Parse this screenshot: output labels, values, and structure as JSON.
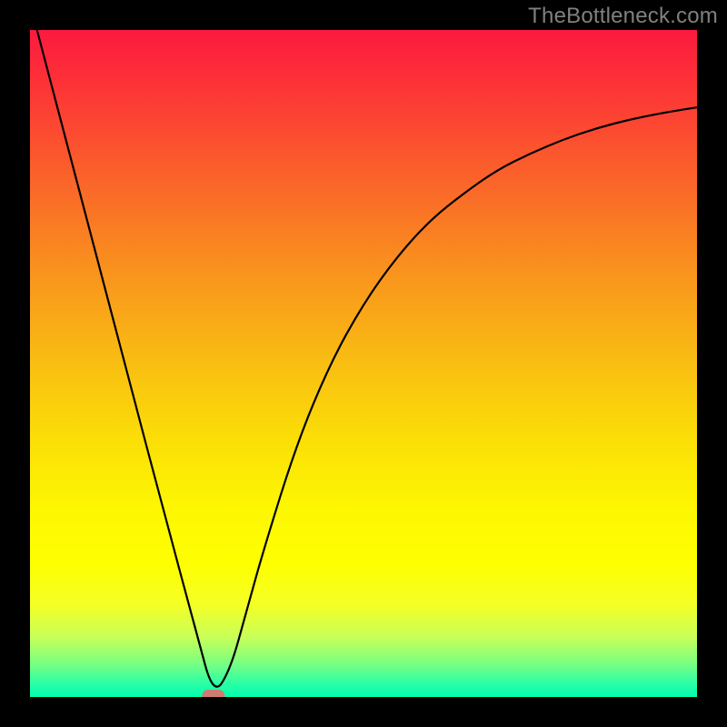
{
  "watermark": "TheBottleneck.com",
  "chart_data": {
    "type": "line",
    "title": "",
    "xlabel": "",
    "ylabel": "",
    "xlim": [
      0,
      100
    ],
    "ylim": [
      0,
      100
    ],
    "series": [
      {
        "name": "bottleneck-curve",
        "x": [
          0,
          5,
          10,
          15,
          20,
          25,
          27.5,
          30,
          32.5,
          35,
          40,
          45,
          50,
          55,
          60,
          65,
          70,
          75,
          80,
          85,
          90,
          95,
          100
        ],
        "values": [
          104,
          85,
          66,
          47,
          28,
          9.5,
          0.2,
          4,
          13,
          22,
          38,
          50,
          59,
          66,
          71.5,
          75.5,
          79,
          81.5,
          83.6,
          85.3,
          86.6,
          87.6,
          88.4
        ]
      }
    ],
    "marker": {
      "x": 27.5,
      "y": 0.2
    },
    "gradient_stops": [
      {
        "offset": 0.0,
        "color": "#fc1a3f"
      },
      {
        "offset": 0.08,
        "color": "#fd3237"
      },
      {
        "offset": 0.2,
        "color": "#fb5b2c"
      },
      {
        "offset": 0.35,
        "color": "#f98f1e"
      },
      {
        "offset": 0.5,
        "color": "#f9be12"
      },
      {
        "offset": 0.62,
        "color": "#fbe006"
      },
      {
        "offset": 0.72,
        "color": "#fdf702"
      },
      {
        "offset": 0.8,
        "color": "#feff01"
      },
      {
        "offset": 0.86,
        "color": "#f5ff24"
      },
      {
        "offset": 0.91,
        "color": "#c8ff58"
      },
      {
        "offset": 0.95,
        "color": "#79ff82"
      },
      {
        "offset": 0.98,
        "color": "#2afea6"
      },
      {
        "offset": 1.0,
        "color": "#02feb0"
      }
    ],
    "frame_color": "#000000",
    "curve_color": "#000000",
    "marker_fill": "#cf7b71",
    "marker_stroke": "#cf7b71"
  }
}
